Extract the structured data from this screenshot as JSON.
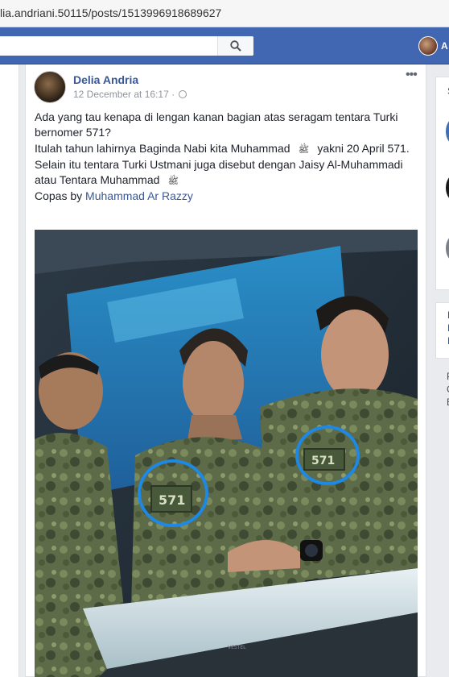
{
  "browser": {
    "url": "lia.andriani.50115/posts/1513996918689627"
  },
  "topbar": {
    "user_initial": "A",
    "icons": [
      "search-icon"
    ]
  },
  "post": {
    "author": "Delia Andria",
    "timestamp": "12 December at 16:17",
    "separator": "·",
    "more_label": "•••",
    "text": {
      "line1": "Ada yang tau kenapa di lengan kanan bagian atas seragam tentara Turki bernomer 571?",
      "line2a": "Itulah tahun lahirnya Baginda Nabi kita Muhammad",
      "honorific": "ﷺ",
      "line2b": "yakni 20 April 571.",
      "line3a": "Selain itu tentara Turki Ustmani juga disebut dengan Jaisy Al-Muhammadi atau Tentara Muhammad",
      "line4_prefix": "Copas by",
      "line4_link": "Muhammad Ar Razzy"
    },
    "photo": {
      "patch_number": "571",
      "monitor_brand": "VESTEL",
      "highlight_color": "#1e88e5"
    }
  },
  "rightcol": {
    "letters": [
      "S",
      "E",
      "E",
      "E",
      "P",
      "C",
      "E"
    ]
  },
  "colors": {
    "facebook_blue": "#4267b2",
    "link_blue": "#385898",
    "page_bg": "#e9ebee"
  }
}
